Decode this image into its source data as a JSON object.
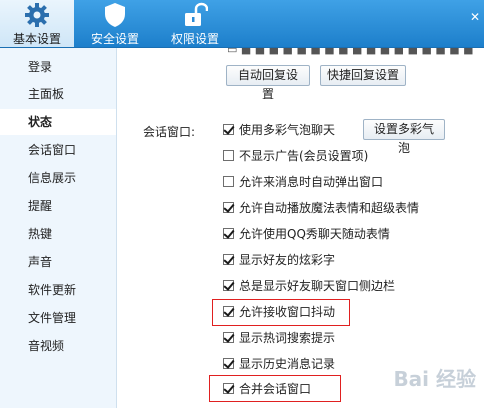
{
  "tabs": [
    {
      "label": "基本设置",
      "icon": "gear-icon",
      "active": true
    },
    {
      "label": "安全设置",
      "icon": "shield-icon",
      "active": false
    },
    {
      "label": "权限设置",
      "icon": "unlock-icon",
      "active": false
    }
  ],
  "sidebar": {
    "items": [
      {
        "label": "登录"
      },
      {
        "label": "主面板"
      },
      {
        "label": "状态",
        "active": true
      },
      {
        "label": "会话窗口"
      },
      {
        "label": "信息展示"
      },
      {
        "label": "提醒"
      },
      {
        "label": "热键"
      },
      {
        "label": "声音"
      },
      {
        "label": "软件更新"
      },
      {
        "label": "文件管理"
      },
      {
        "label": "音视频"
      }
    ]
  },
  "status": {
    "buttons": {
      "auto_reply": "自动回复设置",
      "quick_reply": "快捷回复设置"
    }
  },
  "session": {
    "label": "会话窗口:",
    "bubble_button": "设置多彩气泡",
    "options": [
      {
        "label": "使用多彩气泡聊天",
        "checked": true
      },
      {
        "label": "不显示广告(会员设置项)",
        "checked": false
      },
      {
        "label": "允许来消息时自动弹出窗口",
        "checked": false
      },
      {
        "label": "允许自动播放魔法表情和超级表情",
        "checked": true
      },
      {
        "label": "允许使用QQ秀聊天随动表情",
        "checked": true
      },
      {
        "label": "显示好友的炫彩字",
        "checked": true
      },
      {
        "label": "总是显示好友聊天窗口侧边栏",
        "checked": true
      },
      {
        "label": "允许接收窗口抖动",
        "checked": true,
        "highlighted": true
      },
      {
        "label": "显示热词搜索提示",
        "checked": true
      },
      {
        "label": "显示历史消息记录",
        "checked": true
      },
      {
        "label": "合并会话窗口",
        "checked": true,
        "highlighted": true
      }
    ]
  },
  "colors": {
    "toolbar": "#2a8ad6",
    "sidebar_bg": "#eef6fd",
    "highlight": "#e02020"
  }
}
